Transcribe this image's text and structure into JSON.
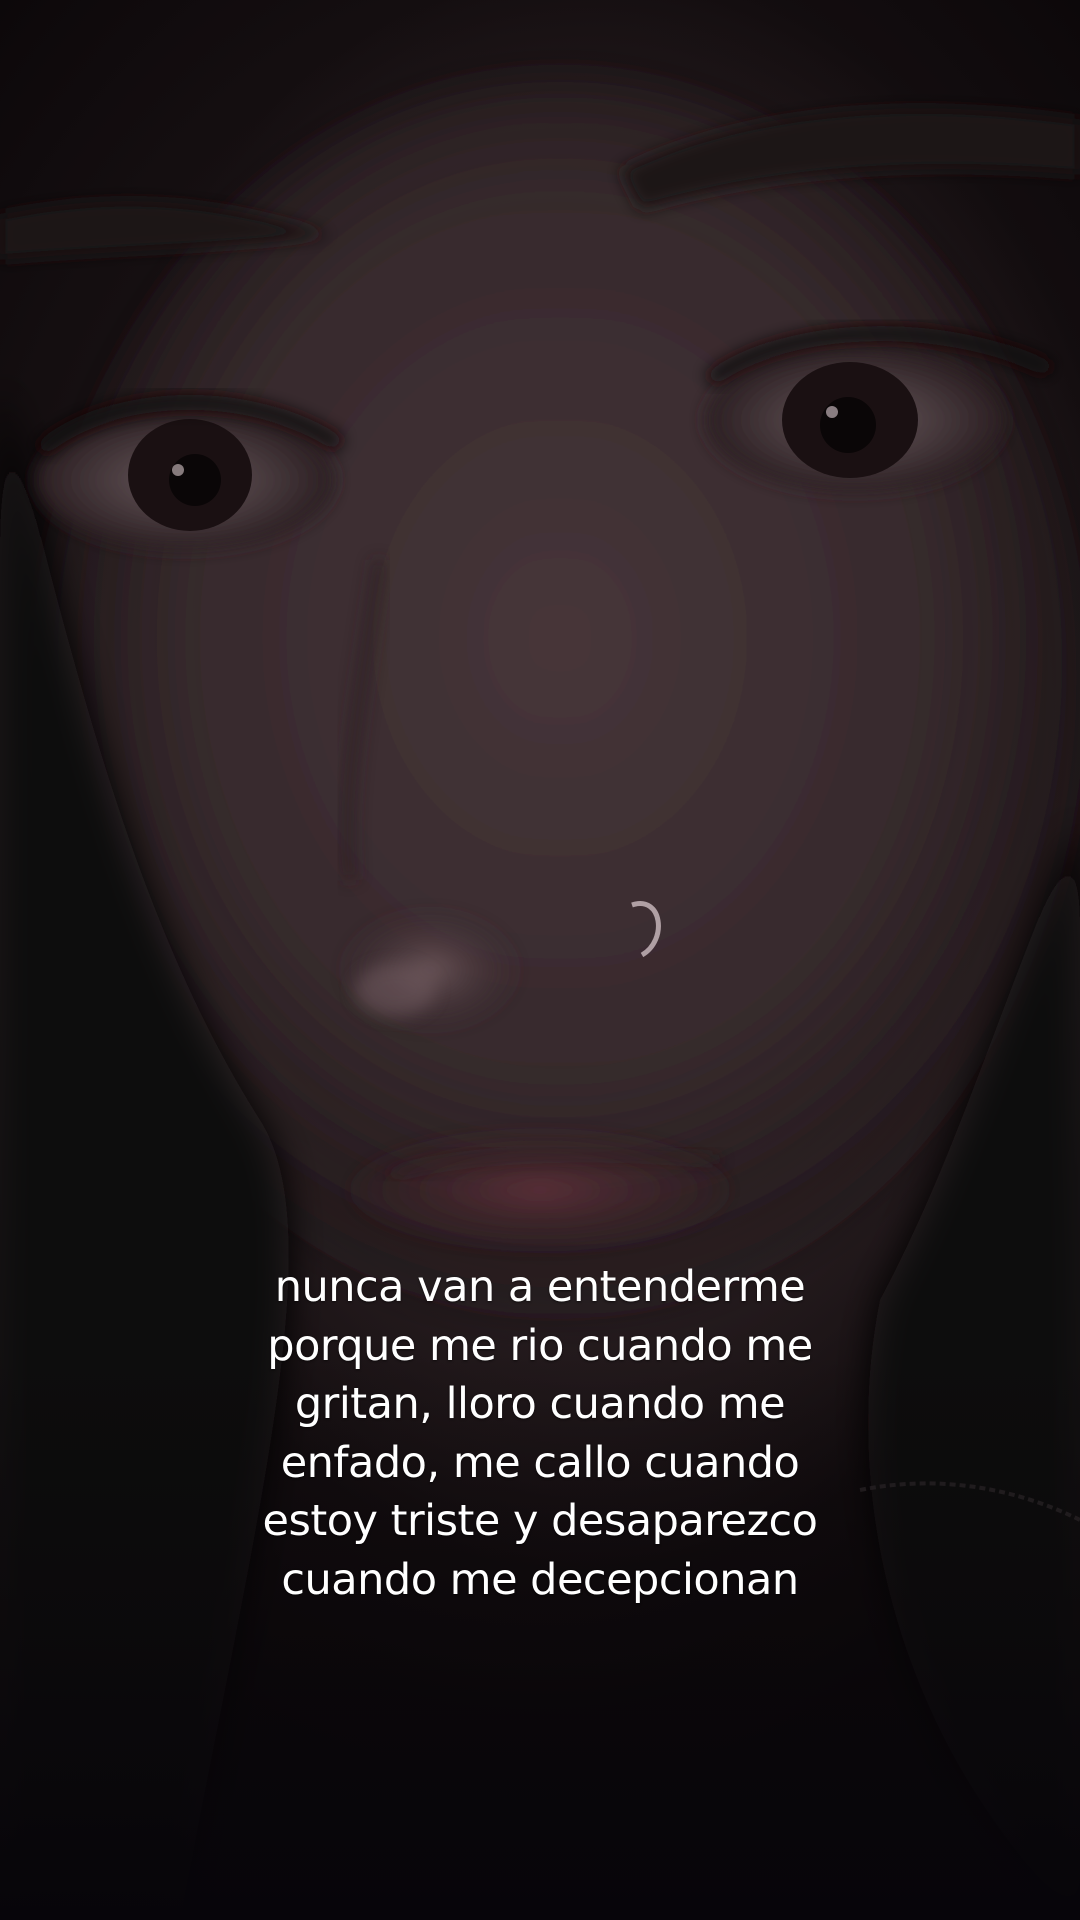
{
  "caption": {
    "lines": [
      "nunca van a entenderme",
      "porque me rio cuando me",
      "gritan, lloro cuando me",
      "enfado, me callo cuando",
      "estoy triste y desaparezco",
      "cuando me decepcionan"
    ]
  }
}
